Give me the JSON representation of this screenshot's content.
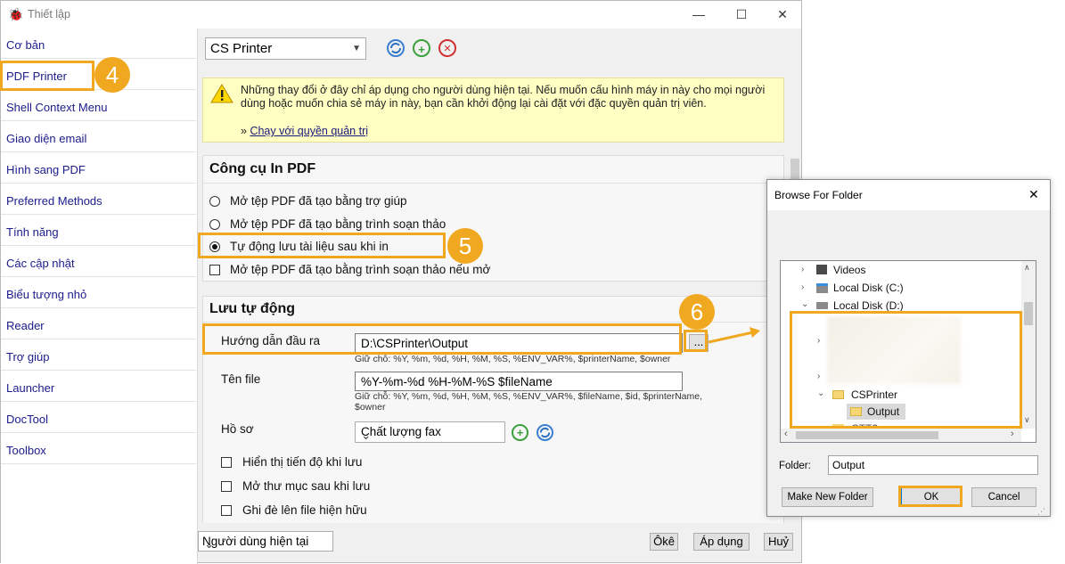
{
  "window": {
    "title": "Thiết lập",
    "minimize_icon": "—",
    "maximize_icon": "☐",
    "close_icon": "✕"
  },
  "sidebar": {
    "items": [
      {
        "label": "Cơ bản"
      },
      {
        "label": "PDF Printer"
      },
      {
        "label": "Shell Context Menu"
      },
      {
        "label": "Giao diện email"
      },
      {
        "label": "Hình sang PDF"
      },
      {
        "label": "Preferred Methods"
      },
      {
        "label": "Tính năng"
      },
      {
        "label": "Các cập nhật"
      },
      {
        "label": "Biểu tượng nhỏ"
      },
      {
        "label": "Reader"
      },
      {
        "label": "Trợ giúp"
      },
      {
        "label": "Launcher"
      },
      {
        "label": "DocTool"
      },
      {
        "label": "Toolbox"
      }
    ],
    "selected_index": 1
  },
  "toolbar": {
    "printer_select": "CS Printer",
    "refresh_icon": "refresh-icon",
    "add_icon": "+",
    "remove_icon": "✕"
  },
  "notice": {
    "text": "Những thay đổi ở đây chỉ áp dụng cho người dùng hiện tại. Nếu muốn cấu hình máy in này cho mọi người dùng hoặc muốn chia sẻ máy in này, bạn cần khởi động lại cài đặt với đặc quyền quản trị viên.",
    "link_prefix": "»",
    "link": "Chạy với quyền quản trị"
  },
  "tools_panel": {
    "title": "Công cụ In PDF",
    "options": [
      {
        "label": "Mở tệp PDF đã tạo bằng trợ giúp",
        "type": "radio",
        "checked": false
      },
      {
        "label": "Mở tệp PDF đã tạo bằng trình soạn thảo",
        "type": "radio",
        "checked": false
      },
      {
        "label": "Tự động lưu tài liệu sau khi in",
        "type": "radio",
        "checked": true
      },
      {
        "label": "Mở tệp PDF đã tạo bằng trình soạn thảo nếu mở",
        "type": "checkbox",
        "checked": false
      }
    ]
  },
  "autosave_panel": {
    "title": "Lưu tự động",
    "output_label": "Hướng dẫn đầu ra",
    "output_value": "D:\\CSPrinter\\Output",
    "browse_label": "...",
    "output_hint": "Giữ chỗ: %Y, %m, %d, %H, %M, %S, %ENV_VAR%, $printerName, $owner",
    "filename_label": "Tên file",
    "filename_value": "%Y-%m-%d %H-%M-%S $fileName",
    "filename_hint_1": "Giữ chỗ: %Y, %m, %d, %H, %M, %S, %ENV_VAR%, $fileName, $id, $printerName,",
    "filename_hint_2": "$owner",
    "profile_label": "Hồ sơ",
    "profile_value": "Chất lượng fax",
    "checkboxes": [
      {
        "label": "Hiển thị tiến độ khi lưu",
        "checked": false
      },
      {
        "label": "Mở thư mục sau khi lưu",
        "checked": false
      },
      {
        "label": "Ghi đè lên file hiện hữu",
        "checked": false
      }
    ]
  },
  "footer": {
    "scope_select": "Người dùng hiện tại",
    "ok": "Ôkê",
    "apply": "Áp dụng",
    "cancel": "Huỷ"
  },
  "dialog": {
    "title": "Browse For Folder",
    "close_icon": "✕",
    "tree": [
      {
        "label": "Videos",
        "icon": "video-folder-icon",
        "expander": "›"
      },
      {
        "label": "Local Disk (C:)",
        "icon": "drive-icon",
        "expander": "›"
      },
      {
        "label": "Local Disk (D:)",
        "icon": "drive-icon",
        "expander": "⌄"
      },
      {
        "label": "CSPrinter",
        "icon": "folder-icon",
        "expander": "⌄"
      },
      {
        "label": "Output",
        "icon": "folder-icon",
        "expander": ""
      },
      {
        "label": "CTT?",
        "icon": "folder-icon",
        "expander": ""
      }
    ],
    "folder_label": "Folder:",
    "folder_value": "Output",
    "make_new_folder": "Make New Folder",
    "ok": "OK",
    "cancel": "Cancel"
  },
  "annotations": {
    "step4": "4",
    "step5": "5",
    "step6": "6",
    "color": "#f0a820"
  }
}
